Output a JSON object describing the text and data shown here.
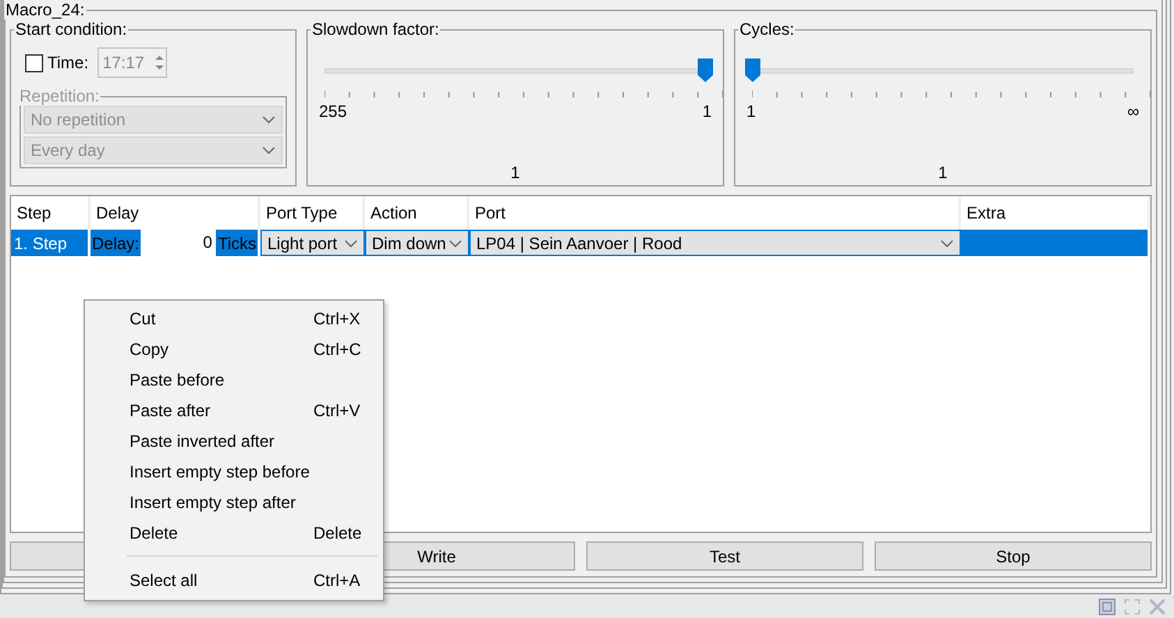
{
  "group": {
    "title": "Macro_24:"
  },
  "start_condition": {
    "title": "Start condition:",
    "time_checked": false,
    "time_label": "Time:",
    "time_value": "17:17",
    "repetition": {
      "title": "Repetition:",
      "disabled": true,
      "mode": "No repetition",
      "interval": "Every day"
    }
  },
  "sliders": [
    {
      "title": "Slowdown factor:",
      "min_label": "255",
      "max_label": "1",
      "value": "1",
      "level": 1
    },
    {
      "title": "Cycles:",
      "min_label": "1",
      "max_label": "∞",
      "value": "1",
      "level": 0
    }
  ],
  "table": {
    "columns": [
      "Step",
      "Delay",
      "Port Type",
      "Action",
      "Port",
      "Extra"
    ],
    "rows": [
      {
        "selected": true,
        "step": "1. Step",
        "delay_label": "Delay:",
        "delay": "0",
        "delay_unit": "Ticks",
        "port_type": "Light port",
        "action": "Dim down",
        "port": "LP04 | Sein Aanvoer | Rood"
      }
    ]
  },
  "buttons": [
    "Write",
    "Test",
    "Stop"
  ],
  "context_menu": [
    {
      "kind": "item",
      "label": "Cut",
      "shortcut": "Ctrl+X"
    },
    {
      "kind": "item",
      "label": "Copy",
      "shortcut": "Ctrl+C"
    },
    {
      "kind": "item",
      "label": "Paste before"
    },
    {
      "kind": "item",
      "label": "Paste after",
      "shortcut": "Ctrl+V"
    },
    {
      "kind": "item",
      "label": "Paste inverted after"
    },
    {
      "kind": "item",
      "label": "Insert empty step before"
    },
    {
      "kind": "item",
      "label": "Insert empty step after"
    },
    {
      "kind": "item",
      "label": "Delete",
      "shortcut": "Delete"
    },
    {
      "kind": "separator"
    },
    {
      "kind": "item",
      "label": "Select all",
      "shortcut": "Ctrl+A"
    }
  ]
}
